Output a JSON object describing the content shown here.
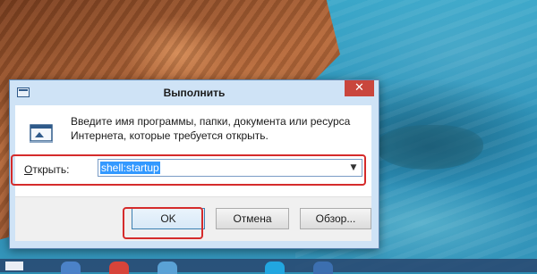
{
  "dialog": {
    "title": "Выполнить",
    "close_glyph": "✕",
    "prompt_line1": "Введите имя программы, папки, документа или ресурса",
    "prompt_line2": "Интернета, которые требуется открыть.",
    "open_label_accel": "О",
    "open_label_rest": "ткрыть:",
    "open_value": "shell:startup",
    "dropdown_icon": "chevron-down-icon",
    "buttons": {
      "ok": "OK",
      "cancel": "Отмена",
      "browse": "Обзор..."
    }
  },
  "colors": {
    "highlight": "#d52b2b",
    "close_button": "#c9463d",
    "selection": "#3399ff"
  },
  "taskbar": {
    "items": [
      "windows-icon",
      "chrome-icon",
      "app-icon",
      "app-icon",
      "skype-icon",
      "app-icon"
    ]
  }
}
